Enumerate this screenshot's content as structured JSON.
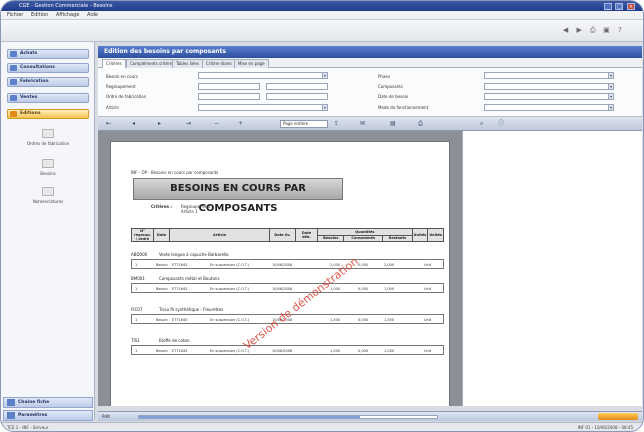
{
  "window": {
    "title": "CGE - Gestion Commerciale - Besoins",
    "controls": [
      "_",
      "□",
      "×"
    ]
  },
  "menu": [
    "Fichier",
    "Edition",
    "Affichage",
    "Aide"
  ],
  "sidebar": {
    "items": [
      {
        "label": "Achats"
      },
      {
        "label": "Consultations"
      },
      {
        "label": "Fabrication"
      },
      {
        "label": "Ventes"
      },
      {
        "label": "Editions",
        "active": true
      }
    ],
    "subitems": [
      {
        "label": "Ordres de fabrication"
      },
      {
        "label": "Besoins"
      },
      {
        "label": "Nomenclatures"
      }
    ],
    "bottom": [
      {
        "label": "Chaine fiche"
      },
      {
        "label": "Paramètres"
      }
    ]
  },
  "panel": {
    "title": "Edition des besoins par composants"
  },
  "tabs": [
    "Critères",
    "Compléments critères",
    "Tables liées",
    "Critère libres",
    "Mise en page"
  ],
  "filters": {
    "left": [
      {
        "label": "Besoin en cours"
      },
      {
        "label": "Regroupement"
      },
      {
        "label": "Ordre de fabrication"
      },
      {
        "label": "Article"
      }
    ],
    "right": [
      {
        "label": "Phase"
      },
      {
        "label": "Composants"
      },
      {
        "label": "Date de besoin"
      },
      {
        "label": "Mode de fonctionnement"
      }
    ]
  },
  "doc_toolbar": {
    "zoom": "Page entière"
  },
  "report": {
    "breadcrumb": "INF - OP - Besoins en cours par composants",
    "title": "BESOINS EN COURS PAR COMPOSANTS",
    "criteria_label": "Critères :",
    "criteria_value_1": "Regroupement",
    "criteria_value_2": "Article 1",
    "headers": [
      "N° regroup. / ordre",
      "Date",
      "Article",
      "Date liv.",
      "Date déb.",
      "Besoins",
      "Consommés",
      "Restants",
      "Unités",
      "Unités"
    ],
    "quantities_header": "Quantités",
    "groups": [
      {
        "code": "ABD000",
        "label": "Veste longue à capuche Barbarella",
        "line": {
          "num": "1",
          "status": "Besoin",
          "ref": "ET71645",
          "desc": "En suspension (C.O.T.)",
          "date": "10/06/2008",
          "qty1": "2,000",
          "qty2": "0,000",
          "qty3": "2,000",
          "unit": "Unit"
        }
      },
      {
        "code": "BM001",
        "label": "Composants métal et Boutons",
        "line": {
          "num": "1",
          "status": "Besoin",
          "ref": "ET71645",
          "desc": "En suspension (C.O.T.)",
          "date": "10/06/2008",
          "qty1": "1,000",
          "qty2": "0,000",
          "qty3": "1,000",
          "unit": "Unit"
        }
      },
      {
        "code": "FIC07",
        "label": "Tissu fil synthétique - Fleurettes",
        "line": {
          "num": "1",
          "status": "Besoin",
          "ref": "ET71645",
          "desc": "En suspension (C.O.T.)",
          "date": "10/06/2008",
          "qty1": "1,500",
          "qty2": "0,000",
          "qty3": "1,500",
          "unit": "Unit"
        }
      },
      {
        "code": "TIS1",
        "label": "Etoffe de coton",
        "line": {
          "num": "1",
          "status": "Besoin",
          "ref": "ET71645",
          "desc": "En suspension (C.O.T.)",
          "date": "10/06/2008",
          "qty1": "1,000",
          "qty2": "0,000",
          "qty3": "1,000",
          "unit": "Unit"
        }
      }
    ],
    "watermark": "Version de démonstration"
  },
  "statusbar": {
    "left": "Prêt",
    "progress": 0.74
  },
  "bottom_status": {
    "left": "TCE 1 - INF - Serveur",
    "right": "INF 01 - 10/06/2008 - 08:45"
  }
}
